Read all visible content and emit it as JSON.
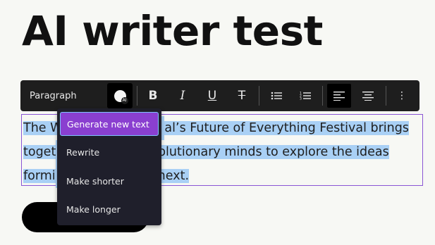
{
  "page": {
    "title": "AI writer test"
  },
  "toolbar": {
    "block_type": "Paragraph",
    "ai_label": "AI",
    "bold": "B",
    "italic": "I",
    "underline": "U",
    "strikethrough": "T",
    "more": "⋮"
  },
  "content": {
    "paragraph_start": "The W",
    "paragraph_line1_end": "al’s Future of Everything Festival brings",
    "paragraph_line2_start": "toget",
    "paragraph_line2_end": "olutionary minds to explore the ideas",
    "paragraph_line3_start": "formi",
    "paragraph_line3_end": "next."
  },
  "ai_menu": {
    "items": [
      "Generate new text",
      "Rewrite",
      "Make shorter",
      "Make longer"
    ]
  },
  "colors": {
    "accent": "#8a3fd0",
    "selection": "#a9d0f5",
    "toolbar_bg": "#1e1e1e"
  }
}
